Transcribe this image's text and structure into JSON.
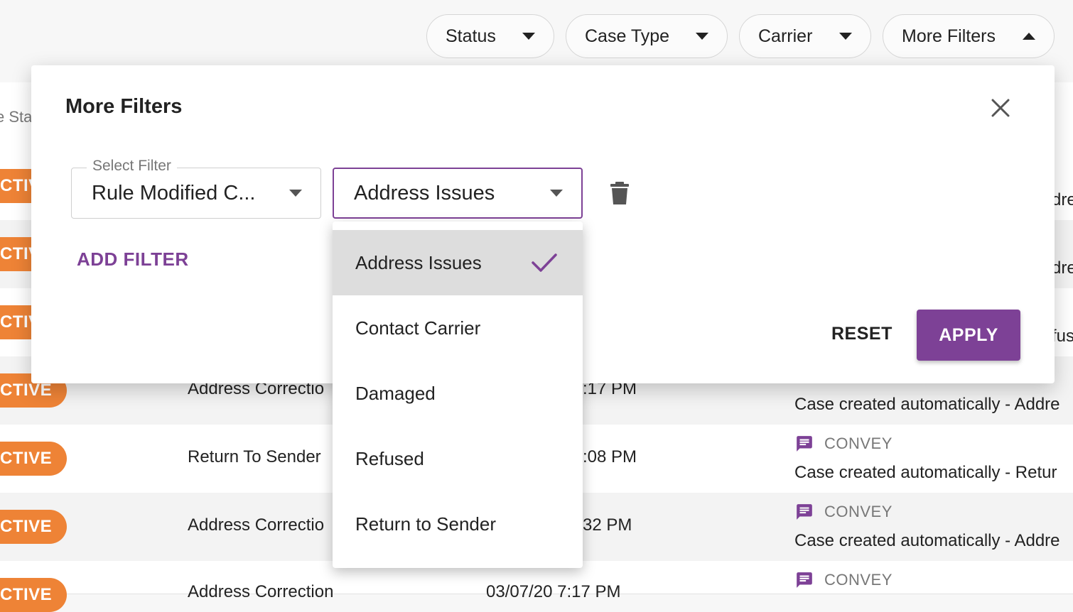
{
  "filter_bar": {
    "pills": [
      {
        "label": "Status",
        "icon": "caret-down-icon"
      },
      {
        "label": "Case Type",
        "icon": "caret-down-icon"
      },
      {
        "label": "Carrier",
        "icon": "caret-down-icon"
      },
      {
        "label": "More Filters",
        "icon": "caret-up-icon"
      }
    ]
  },
  "table": {
    "header_partial": "e Sta",
    "rows": [
      {
        "badge": "CTIV",
        "right_text": "dre"
      },
      {
        "badge": "CTIV",
        "right_text": "dre"
      },
      {
        "badge": "CTIV",
        "right_text": "fus"
      },
      {
        "badge": "CTIVE",
        "type": "Address Correctio",
        "time": ":17 PM",
        "note": "Case created automatically - Addre"
      },
      {
        "badge": "CTIVE",
        "type": "Return To Sender",
        "time": ":08 PM",
        "source": "CONVEY",
        "note": "Case created automatically - Retur"
      },
      {
        "badge": "CTIVE",
        "type": "Address Correctio",
        "time": "32 PM",
        "source": "CONVEY",
        "note": "Case created automatically - Addre"
      },
      {
        "badge": "CTIVE",
        "type": "Address Correction",
        "time": "03/07/20 7:17 PM",
        "source": "CONVEY"
      }
    ]
  },
  "modal": {
    "title": "More Filters",
    "select_filter_label": "Select Filter",
    "select_filter_value": "Rule Modified C...",
    "value_select": "Address Issues",
    "add_filter": "ADD FILTER",
    "reset": "RESET",
    "apply": "APPLY"
  },
  "dropdown": {
    "options": [
      "Address Issues",
      "Contact Carrier",
      "Damaged",
      "Refused",
      "Return to Sender"
    ],
    "selected": "Address Issues"
  },
  "colors": {
    "accent": "#7d4196",
    "badge": "#ee8336"
  }
}
